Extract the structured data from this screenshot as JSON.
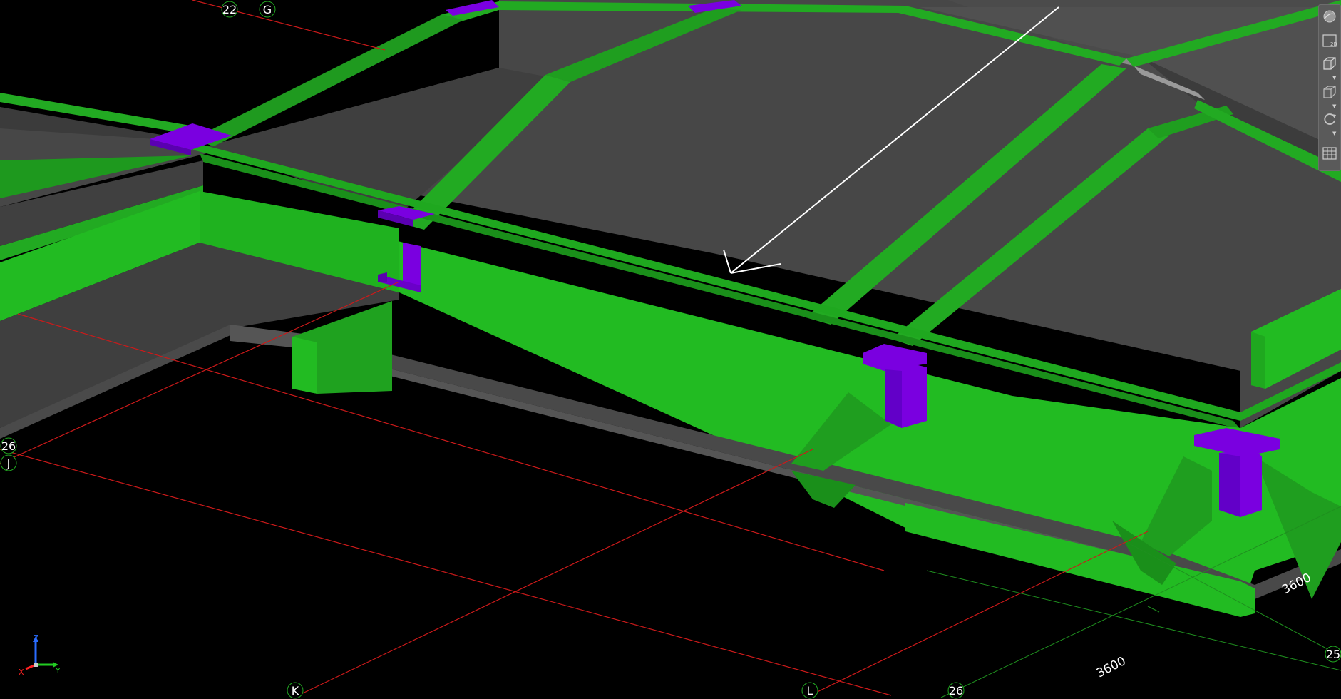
{
  "grid": {
    "labels": {
      "g22": "22",
      "gG": "G",
      "g26": "26",
      "gJ": "J",
      "gK": "K",
      "gL": "L",
      "g26b": "26",
      "g25": "25"
    }
  },
  "dimensions": {
    "d1": "3600",
    "d2": "3600"
  },
  "axes": {
    "x": "X",
    "y": "Y",
    "z": "Z"
  },
  "toolbar": {
    "view2d_label": "2D"
  },
  "colors": {
    "background": "#000000",
    "beam_green": "#22bb22",
    "slab_gray": "#474747",
    "connection_purple": "#7a00e0",
    "grid_red": "#cc1a1a",
    "dimension_green": "#1f8f1f"
  }
}
